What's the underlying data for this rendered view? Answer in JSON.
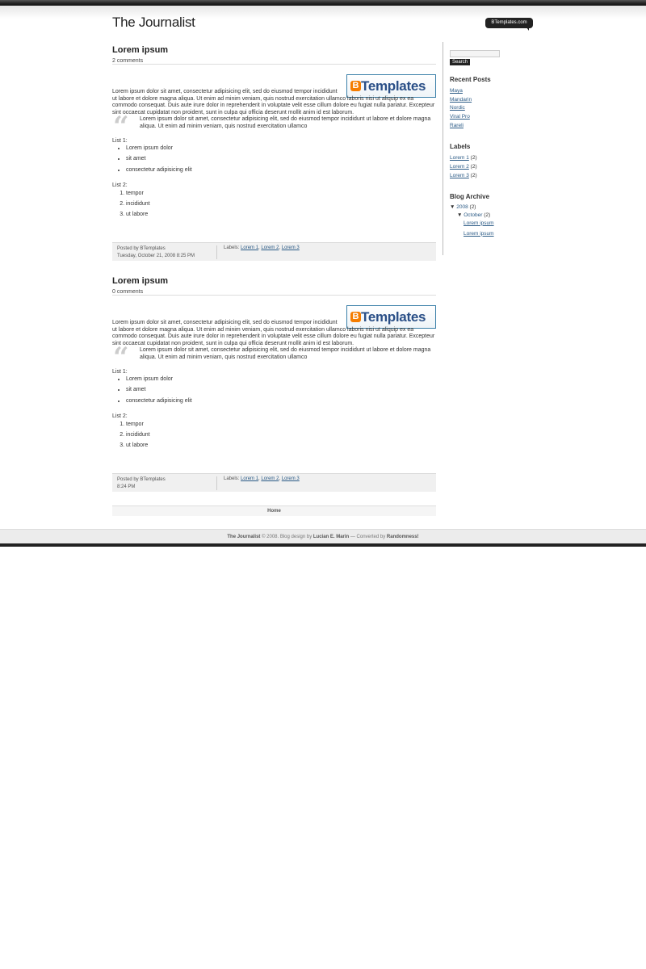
{
  "header": {
    "title": "The Journalist",
    "badge": "BTemplates.com"
  },
  "posts": [
    {
      "title": "Lorem ipsum",
      "comments": "2 comments",
      "image_text": "Templates",
      "body": "Lorem ipsum dolor sit amet, consectetur adipisicing elit, sed do eiusmod tempor incididunt ut labore et dolore magna aliqua. Ut enim ad minim veniam, quis nostrud exercitation ullamco laboris nisi ut aliquip ex ea commodo consequat. Duis aute irure dolor in reprehenderit in voluptate velit esse cillum dolore eu fugiat nulla pariatur. Excepteur sint occaecat cupidatat non proident, sunt in culpa qui officia deserunt mollit anim id est laborum.",
      "quote": "Lorem ipsum dolor sit amet, consectetur adipisicing elit, sed do eiusmod tempor incididunt ut labore et dolore magna aliqua. Ut enim ad minim veniam, quis nostrud exercitation ullamco",
      "list1_title": "List 1:",
      "list1": [
        "Lorem ipsum dolor",
        "sit amet",
        "consectetur adipisicing elit"
      ],
      "list2_title": "List 2:",
      "list2": [
        "tempor",
        "incididunt",
        "ut labore"
      ],
      "posted_by": "Posted by BTemplates",
      "date": "Tuesday, October 21, 2008 8:25 PM",
      "labels_prefix": "Labels:",
      "labels": [
        "Lorem 1",
        "Lorem 2",
        "Lorem 3"
      ]
    },
    {
      "title": "Lorem ipsum",
      "comments": "0 comments",
      "image_text": "Templates",
      "body": "Lorem ipsum dolor sit amet, consectetur adipisicing elit, sed do eiusmod tempor incididunt ut labore et dolore magna aliqua. Ut enim ad minim veniam, quis nostrud exercitation ullamco laboris nisi ut aliquip ex ea commodo consequat. Duis aute irure dolor in reprehenderit in voluptate velit esse cillum dolore eu fugiat nulla pariatur. Excepteur sint occaecat cupidatat non proident, sunt in culpa qui officia deserunt mollit anim id est laborum.",
      "quote": "Lorem ipsum dolor sit amet, consectetur adipisicing elit, sed do eiusmod tempor incididunt ut labore et dolore magna aliqua. Ut enim ad minim veniam, quis nostrud exercitation ullamco",
      "list1_title": "List 1:",
      "list1": [
        "Lorem ipsum dolor",
        "sit amet",
        "consectetur adipisicing elit"
      ],
      "list2_title": "List 2:",
      "list2": [
        "tempor",
        "incididunt",
        "ut labore"
      ],
      "posted_by": "Posted by BTemplates",
      "date": "8:24 PM",
      "labels_prefix": "Labels:",
      "labels": [
        "Lorem 1",
        "Lorem 2",
        "Lorem 3"
      ]
    }
  ],
  "home_link": "Home",
  "sidebar": {
    "search_button": "Search",
    "recent_title": "Recent Posts",
    "recent": [
      "Maya",
      "Mandarin",
      "Nordic",
      "Viral Pro",
      "Rareli"
    ],
    "labels_title": "Labels",
    "labels": [
      {
        "name": "Lorem 1",
        "count": "(2)"
      },
      {
        "name": "Lorem 2",
        "count": "(2)"
      },
      {
        "name": "Lorem 3",
        "count": "(2)"
      }
    ],
    "archive_title": "Blog Archive",
    "archive_year": "2008",
    "archive_year_count": "(2)",
    "archive_month": "October",
    "archive_month_count": "(2)",
    "archive_posts": [
      "Lorem ipsum",
      "Lorem ipsum"
    ]
  },
  "footer": {
    "site": "The Journalist",
    "mid": " © 2008. Blog design by ",
    "designer": "Lucian E. Marin",
    "mid2": " — Converted by ",
    "converter": "Randomness!"
  },
  "colors": {
    "link": "#2a5a85",
    "dark_bar": "#222222",
    "image_border": "#3a7fa8"
  }
}
